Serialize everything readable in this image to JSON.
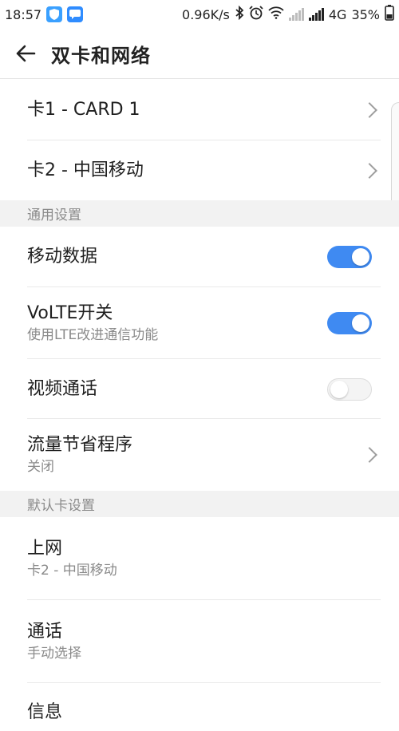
{
  "status_bar": {
    "time": "18:57",
    "speed": "0.96K/s",
    "network_type": "4G",
    "battery": "35%",
    "icons": [
      "shield-app-icon",
      "message-app-icon",
      "bluetooth-icon",
      "alarm-icon",
      "wifi-icon",
      "signal-icon",
      "battery-icon"
    ]
  },
  "app_bar": {
    "title": "双卡和网络",
    "back_icon": "arrow-left-icon"
  },
  "sim_cards": [
    {
      "label": "卡1 - CARD 1"
    },
    {
      "label": "卡2 - 中国移动"
    }
  ],
  "general": {
    "header": "通用设置",
    "mobile_data": {
      "label": "移动数据",
      "enabled": true
    },
    "volte": {
      "label": "VoLTE开关",
      "description": "使用LTE改进通信功能",
      "enabled": true
    },
    "video_call": {
      "label": "视频通话",
      "enabled": false
    },
    "data_saver": {
      "label": "流量节省程序",
      "value": "关闭"
    }
  },
  "defaults": {
    "header": "默认卡设置",
    "internet": {
      "label": "上网",
      "value": "卡2 - 中国移动"
    },
    "calls": {
      "label": "通话",
      "value": "手动选择"
    },
    "messages": {
      "label": "信息"
    }
  },
  "colors": {
    "toggle_on": "#3f8af2",
    "section_bg": "#f2f2f2",
    "subtitle": "#8a8a8a"
  }
}
